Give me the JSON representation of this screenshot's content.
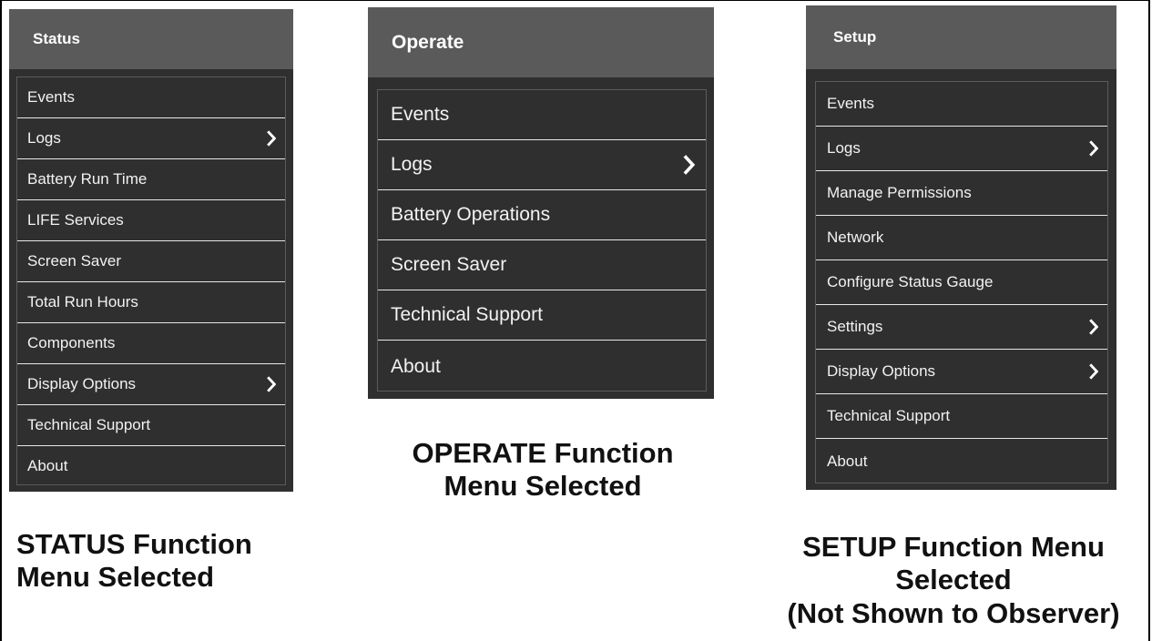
{
  "panels": [
    {
      "title": "Status",
      "items": [
        {
          "label": "Events",
          "submenu": false
        },
        {
          "label": "Logs",
          "submenu": true
        },
        {
          "label": "Battery Run Time",
          "submenu": false
        },
        {
          "label": "LIFE Services",
          "submenu": false
        },
        {
          "label": "Screen Saver",
          "submenu": false
        },
        {
          "label": "Total Run Hours",
          "submenu": false
        },
        {
          "label": "Components",
          "submenu": false
        },
        {
          "label": "Display Options",
          "submenu": true
        },
        {
          "label": "Technical Support",
          "submenu": false
        },
        {
          "label": "About",
          "submenu": false
        }
      ],
      "caption": [
        "STATUS Function",
        "Menu Selected"
      ]
    },
    {
      "title": "Operate",
      "items": [
        {
          "label": "Events",
          "submenu": false
        },
        {
          "label": "Logs",
          "submenu": true
        },
        {
          "label": "Battery Operations",
          "submenu": false
        },
        {
          "label": "Screen Saver",
          "submenu": false
        },
        {
          "label": "Technical Support",
          "submenu": false
        },
        {
          "label": "About",
          "submenu": false
        }
      ],
      "caption": [
        "OPERATE Function",
        "Menu Selected"
      ]
    },
    {
      "title": "Setup",
      "items": [
        {
          "label": "Events",
          "submenu": false
        },
        {
          "label": "Logs",
          "submenu": true
        },
        {
          "label": "Manage Permissions",
          "submenu": false
        },
        {
          "label": "Network",
          "submenu": false
        },
        {
          "label": "Configure Status Gauge",
          "submenu": false
        },
        {
          "label": "Settings",
          "submenu": true
        },
        {
          "label": "Display Options",
          "submenu": true
        },
        {
          "label": "Technical Support",
          "submenu": false
        },
        {
          "label": "About",
          "submenu": false
        }
      ],
      "caption": [
        "SETUP Function Menu",
        "Selected",
        "(Not Shown to Observer)"
      ]
    }
  ],
  "icons": {
    "submenu": "chevron-right-icon"
  },
  "colors": {
    "header": "#5a5a5a",
    "panel": "#2f2f2f",
    "text": "#f2f2f2",
    "divider": "#e8e8e8"
  }
}
